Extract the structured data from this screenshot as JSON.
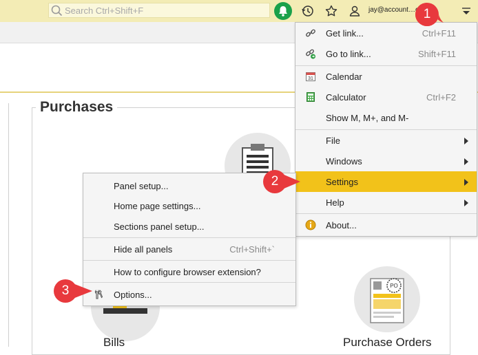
{
  "topbar": {
    "search_placeholder": "Search Ctrl+Shift+F",
    "user_email": "jay@account…com"
  },
  "panel": {
    "title": "Purchases",
    "bills_label": "Bills",
    "purchase_orders_label": "Purchase Orders"
  },
  "main_menu": {
    "get_link": {
      "label": "Get link...",
      "shortcut": "Ctrl+F11"
    },
    "go_to_link": {
      "label": "Go to link...",
      "shortcut": "Shift+F11"
    },
    "calendar": {
      "label": "Calendar",
      "icon_text": "31"
    },
    "calculator": {
      "label": "Calculator",
      "shortcut": "Ctrl+F2"
    },
    "show_m": {
      "label": "Show M, M+, and M-"
    },
    "file": {
      "label": "File"
    },
    "windows": {
      "label": "Windows"
    },
    "settings": {
      "label": "Settings"
    },
    "help": {
      "label": "Help"
    },
    "about": {
      "label": "About..."
    }
  },
  "settings_submenu": {
    "panel_setup": {
      "label": "Panel setup..."
    },
    "home_page_settings": {
      "label": "Home page settings..."
    },
    "sections_panel_setup": {
      "label": "Sections panel setup..."
    },
    "hide_all_panels": {
      "label": "Hide all panels",
      "shortcut": "Ctrl+Shift+`"
    },
    "browser_extension": {
      "label": "How to configure browser extension?"
    },
    "options": {
      "label": "Options..."
    }
  },
  "callouts": [
    "1",
    "2",
    "3"
  ],
  "colors": {
    "topbar": "#f3ecb5",
    "accent": "#f2c21a",
    "callout": "#e8393d",
    "bell": "#1aa14a"
  },
  "icons": {
    "search": "search-icon",
    "bell": "bell-icon",
    "history": "history-icon",
    "star": "star-icon",
    "user": "user-icon",
    "menu": "menu-icon",
    "link": "link-icon",
    "go_link": "go-to-link-icon",
    "calendar": "calendar-icon",
    "calculator": "calculator-icon",
    "info": "info-icon",
    "wrench": "wrench-icon"
  }
}
